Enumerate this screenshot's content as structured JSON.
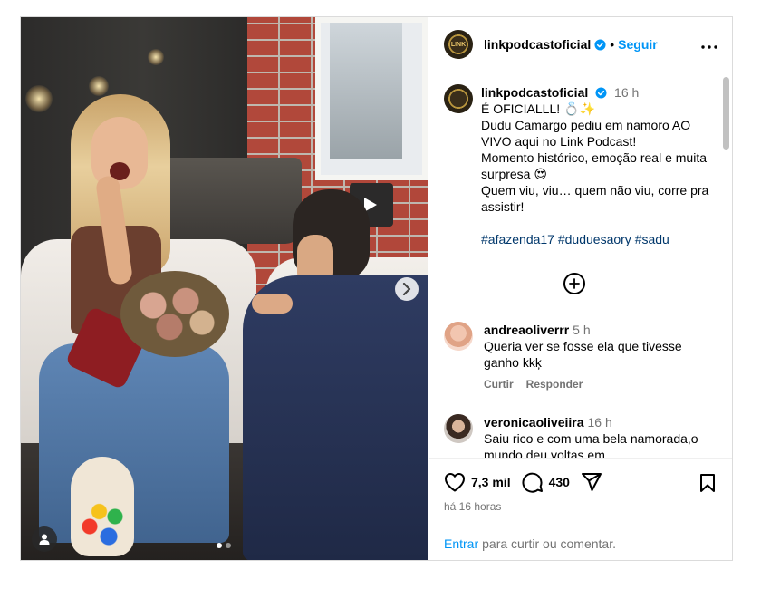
{
  "post": {
    "username": "linkpodcastoficial",
    "separator": "•",
    "follow_label": "Seguir",
    "more_label": "•••",
    "logo_text": "LINK"
  },
  "caption": {
    "username": "linkpodcastoficial",
    "time": "16 h",
    "lines": [
      "É OFICIALLL! 💍✨",
      "Dudu Camargo pediu em namoro AO VIVO aqui no Link Podcast!",
      "Momento histórico, emoção real e muita surpresa 😍",
      "Quem viu, viu… quem não viu, corre pra assistir!"
    ],
    "hashtags": "#afazenda17 #duduesaory #sadu"
  },
  "comments": [
    {
      "username": "andreaoliverrr",
      "time": "5 h",
      "text": "Queria ver se fosse ela que tivesse ganho kkķ",
      "like_label": "Curtir",
      "reply_label": "Responder"
    },
    {
      "username": "veronicaoliveiira",
      "time": "16 h",
      "text": "Saiu rico e com uma bela namorada,o mundo deu voltas em"
    }
  ],
  "actions": {
    "likes": "7,3 mil",
    "comments": "430",
    "posted_ago": "há 16 horas",
    "add_comment_link": "Entrar",
    "add_comment_text": "para curtir ou comentar."
  },
  "carousel": {
    "slides": 2,
    "active_slide": 1
  },
  "colors": {
    "accent": "#0095f6",
    "verified": "#0095f6",
    "secondary_text": "#737373",
    "hashtag": "#00376b",
    "border": "#dbdbdb"
  },
  "icons": [
    "verified-badge-icon",
    "more-options-icon",
    "add-icon",
    "heart-icon",
    "comment-icon",
    "share-icon",
    "bookmark-icon",
    "chevron-right-icon",
    "user-tag-icon"
  ]
}
